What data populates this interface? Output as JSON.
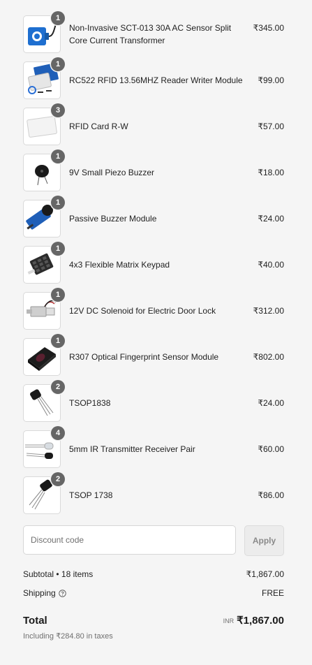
{
  "items": [
    {
      "quantity": "1",
      "name": "Non-Invasive SCT-013 30A AC Sensor Split Core Current Transformer",
      "price": "₹345.00",
      "icon": "current-transformer-icon"
    },
    {
      "quantity": "1",
      "name": "RC522 RFID 13.56MHZ Reader Writer Module",
      "price": "₹99.00",
      "icon": "rfid-module-icon"
    },
    {
      "quantity": "3",
      "name": "RFID Card R-W",
      "price": "₹57.00",
      "icon": "rfid-card-icon"
    },
    {
      "quantity": "1",
      "name": "9V Small Piezo Buzzer",
      "price": "₹18.00",
      "icon": "piezo-buzzer-icon"
    },
    {
      "quantity": "1",
      "name": "Passive Buzzer Module",
      "price": "₹24.00",
      "icon": "buzzer-module-icon"
    },
    {
      "quantity": "1",
      "name": "4x3 Flexible Matrix Keypad",
      "price": "₹40.00",
      "icon": "matrix-keypad-icon"
    },
    {
      "quantity": "1",
      "name": "12V DC Solenoid for Electric Door Lock",
      "price": "₹312.00",
      "icon": "solenoid-lock-icon"
    },
    {
      "quantity": "1",
      "name": "R307 Optical Fingerprint Sensor Module",
      "price": "₹802.00",
      "icon": "fingerprint-sensor-icon"
    },
    {
      "quantity": "2",
      "name": "TSOP1838",
      "price": "₹24.00",
      "icon": "ir-receiver-icon"
    },
    {
      "quantity": "4",
      "name": "5mm IR Transmitter Receiver Pair",
      "price": "₹60.00",
      "icon": "ir-led-pair-icon"
    },
    {
      "quantity": "2",
      "name": "TSOP 1738",
      "price": "₹86.00",
      "icon": "ir-receiver-icon"
    }
  ],
  "discount": {
    "placeholder": "Discount code",
    "value": "",
    "apply_label": "Apply"
  },
  "summary": {
    "subtotal_label": "Subtotal • 18 items",
    "subtotal_value": "₹1,867.00",
    "shipping_label": "Shipping",
    "shipping_value": "FREE",
    "total_label": "Total",
    "currency": "INR",
    "total_value": "₹1,867.00",
    "tax_note": "Including ₹284.80 in taxes"
  },
  "colors": {
    "background": "#f5f5f5",
    "badge": "#666666",
    "muted_text": "#707070"
  }
}
